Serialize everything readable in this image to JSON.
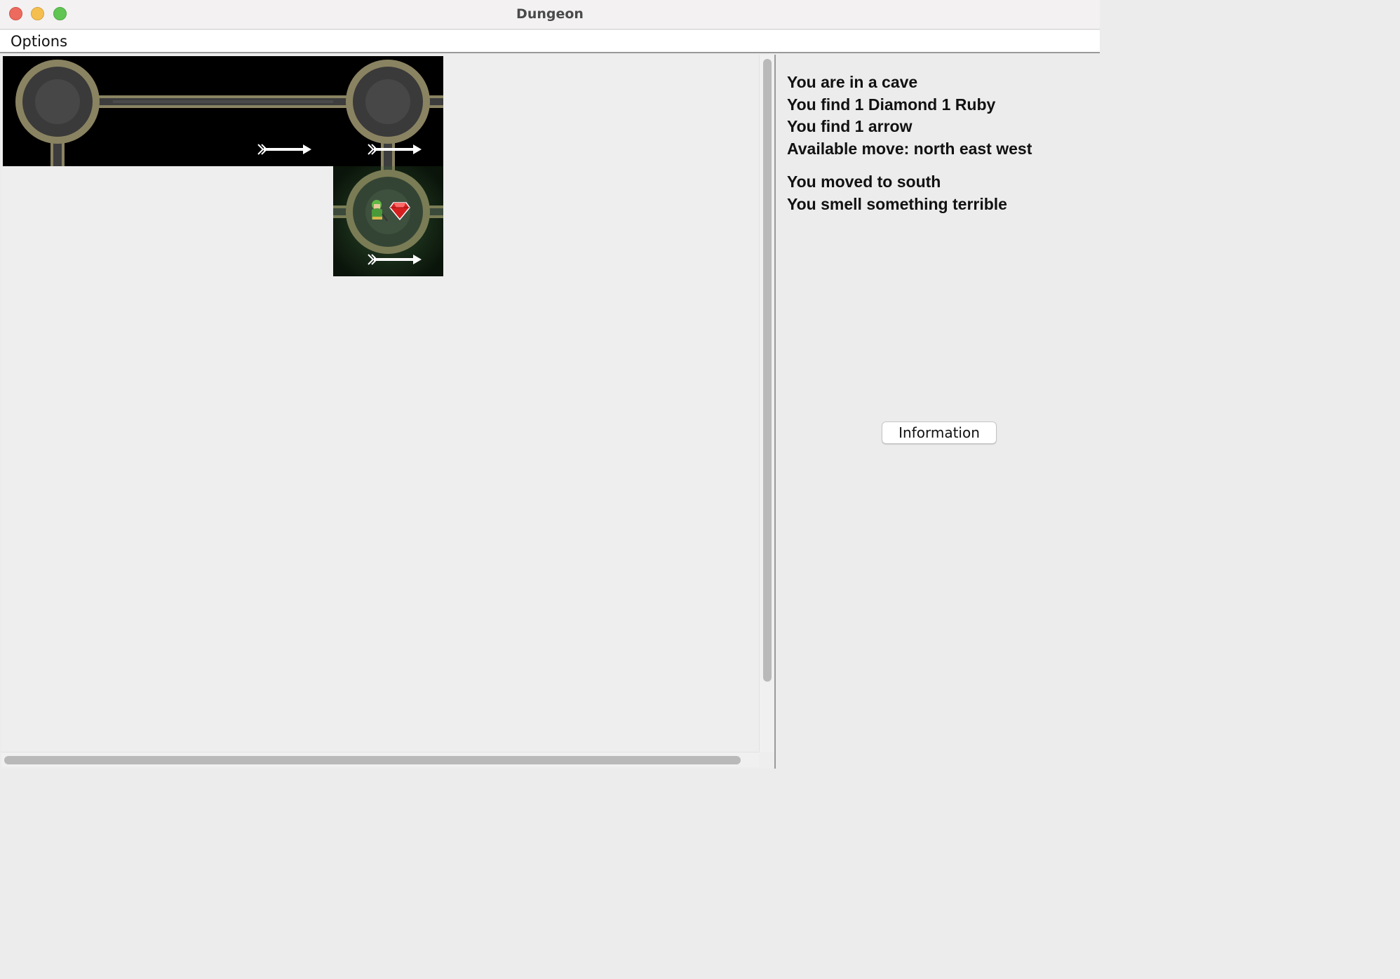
{
  "window": {
    "title": "Dungeon"
  },
  "menubar": {
    "items": [
      {
        "label": "Options"
      }
    ]
  },
  "map": {
    "tiles": [
      {
        "kind": "cave",
        "exits": [
          "east",
          "south"
        ],
        "lit": false,
        "items": []
      },
      {
        "kind": "tunnel",
        "exits": [
          "east",
          "west"
        ],
        "lit": false,
        "items": []
      },
      {
        "kind": "tunnel",
        "exits": [
          "east",
          "west"
        ],
        "lit": false,
        "items": [
          "arrow"
        ]
      },
      {
        "kind": "cave",
        "exits": [
          "east",
          "south",
          "west"
        ],
        "lit": false,
        "items": [
          "arrow"
        ]
      },
      {
        "kind": "cave",
        "exits": [
          "north",
          "east",
          "west"
        ],
        "lit": true,
        "smell": true,
        "items": [
          "player",
          "ruby",
          "arrow"
        ]
      }
    ]
  },
  "info": {
    "lines": [
      "You are in a cave",
      "You find 1 Diamond 1 Ruby",
      "You find 1 arrow",
      "Available move: north east west"
    ],
    "events": [
      "You moved to south",
      "You smell something terrible"
    ],
    "button_label": "Information"
  },
  "colors": {
    "wall": "#8a8362",
    "floor": "#3f3f3f",
    "void": "#000000",
    "smell_glow": "#1c3a1c",
    "ruby": "#d62020",
    "player": "#5fb846"
  }
}
